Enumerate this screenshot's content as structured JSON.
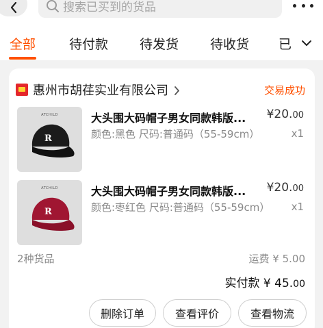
{
  "header": {
    "search_placeholder": "搜索已买到的货品"
  },
  "tabs": [
    {
      "label": "全部",
      "active": true
    },
    {
      "label": "待付款",
      "active": false
    },
    {
      "label": "待发货",
      "active": false
    },
    {
      "label": "待收货",
      "active": false
    },
    {
      "label": "已",
      "active": false
    }
  ],
  "order": {
    "shop_name": "惠州市胡荏实业有限公司",
    "status": "交易成功",
    "items": [
      {
        "title": "大头围大码帽子男女同款韩版...",
        "spec": "颜色:黑色 尺码:普通码（55-59cm）",
        "price_int": "¥20.",
        "price_dec": "00",
        "qty": "x1",
        "color": "#1b1b1b"
      },
      {
        "title": "大头围大码帽子男女同款韩版...",
        "spec": "颜色:枣红色 尺码:普通码（55-59cm）",
        "price_int": "¥20.",
        "price_dec": "00",
        "qty": "x1",
        "color": "#a01632"
      }
    ],
    "goods_count": "2种货品",
    "shipping": "运费 ¥ 5.00",
    "paid_label": "实付款 ¥ 45.",
    "paid_dec": "00",
    "buttons": {
      "delete": "删除订单",
      "review": "查看评价",
      "logistics": "查看物流"
    }
  },
  "colors": {
    "accent": "#ff5000",
    "background": "#f2f2f2"
  }
}
